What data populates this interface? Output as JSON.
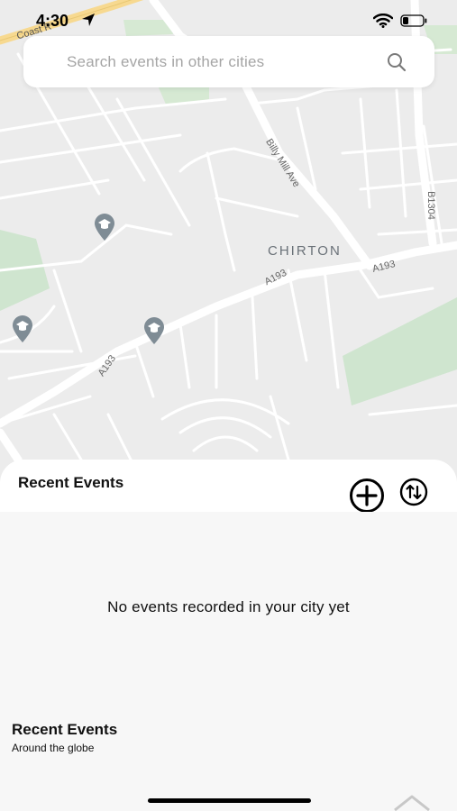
{
  "status_bar": {
    "time": "4:30"
  },
  "search": {
    "placeholder": "Search events in other cities"
  },
  "map": {
    "labels": {
      "coast": "Coast R",
      "billy_mill": "Billy Mill Ave",
      "chirton": "CHIRTON",
      "a193_mid": "A193",
      "a193_right": "A193",
      "a193_left": "A193",
      "b1304": "B1304"
    }
  },
  "sheet": {
    "title": "Recent Events",
    "empty_message": "No events recorded in your city yet"
  },
  "global": {
    "title": "Recent Events",
    "subtitle": "Around the globe"
  },
  "colors": {
    "map_bg": "#ececec",
    "park": "#cfe5cf",
    "road": "#ffffff",
    "poi": "#7f8c95"
  }
}
